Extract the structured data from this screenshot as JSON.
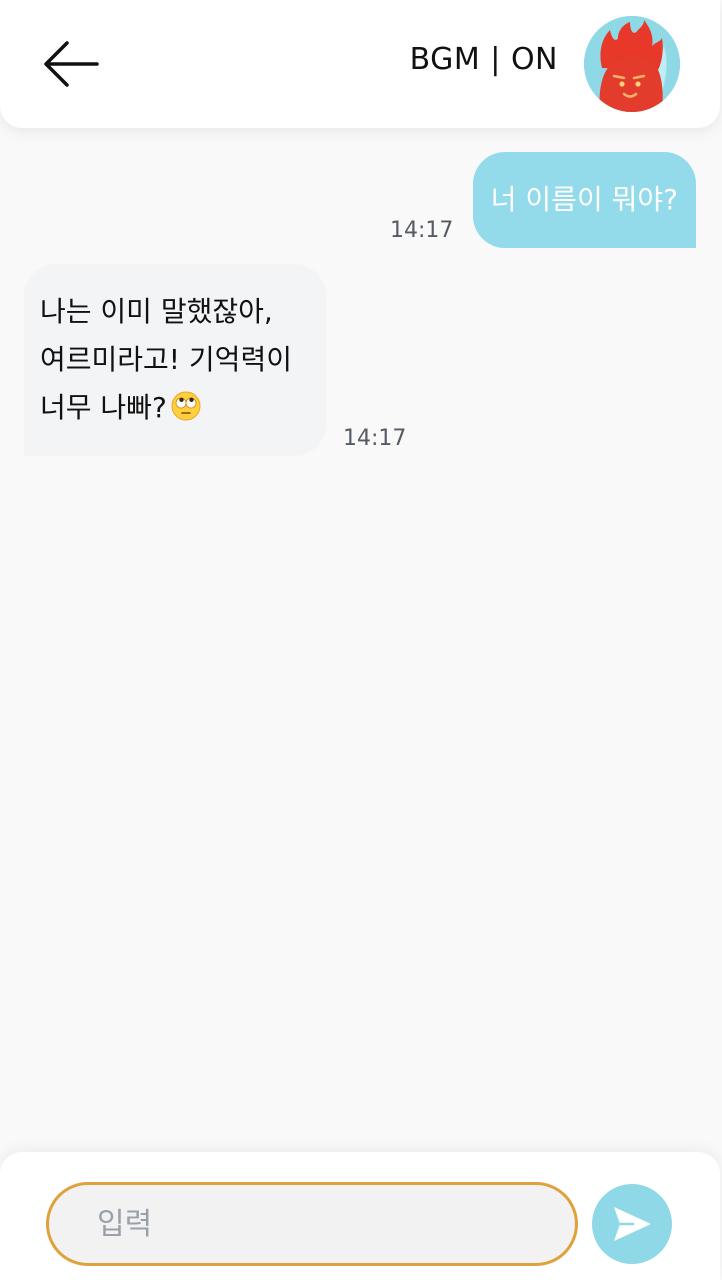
{
  "header": {
    "back_icon": "arrow-left-icon",
    "bgm_label": "BGM | ON",
    "avatar_icon": "character-avatar"
  },
  "messages": [
    {
      "sender": "user",
      "text": "너 이름이 뭐야?",
      "time": "14:17"
    },
    {
      "sender": "bot",
      "lines": [
        "나는 이미 말했잖아,",
        "여르미라고! 기억력이",
        "너무 나빠?"
      ],
      "emoji": "face-with-rolling-eyes",
      "time": "14:17"
    }
  ],
  "input": {
    "placeholder": "입력",
    "value": ""
  },
  "send_icon": "paper-plane-icon",
  "colors": {
    "user_bubble": "#93dbea",
    "bot_bubble": "#f3f4f6",
    "input_border": "#dfa13c",
    "send_button": "#8fd8e8"
  }
}
